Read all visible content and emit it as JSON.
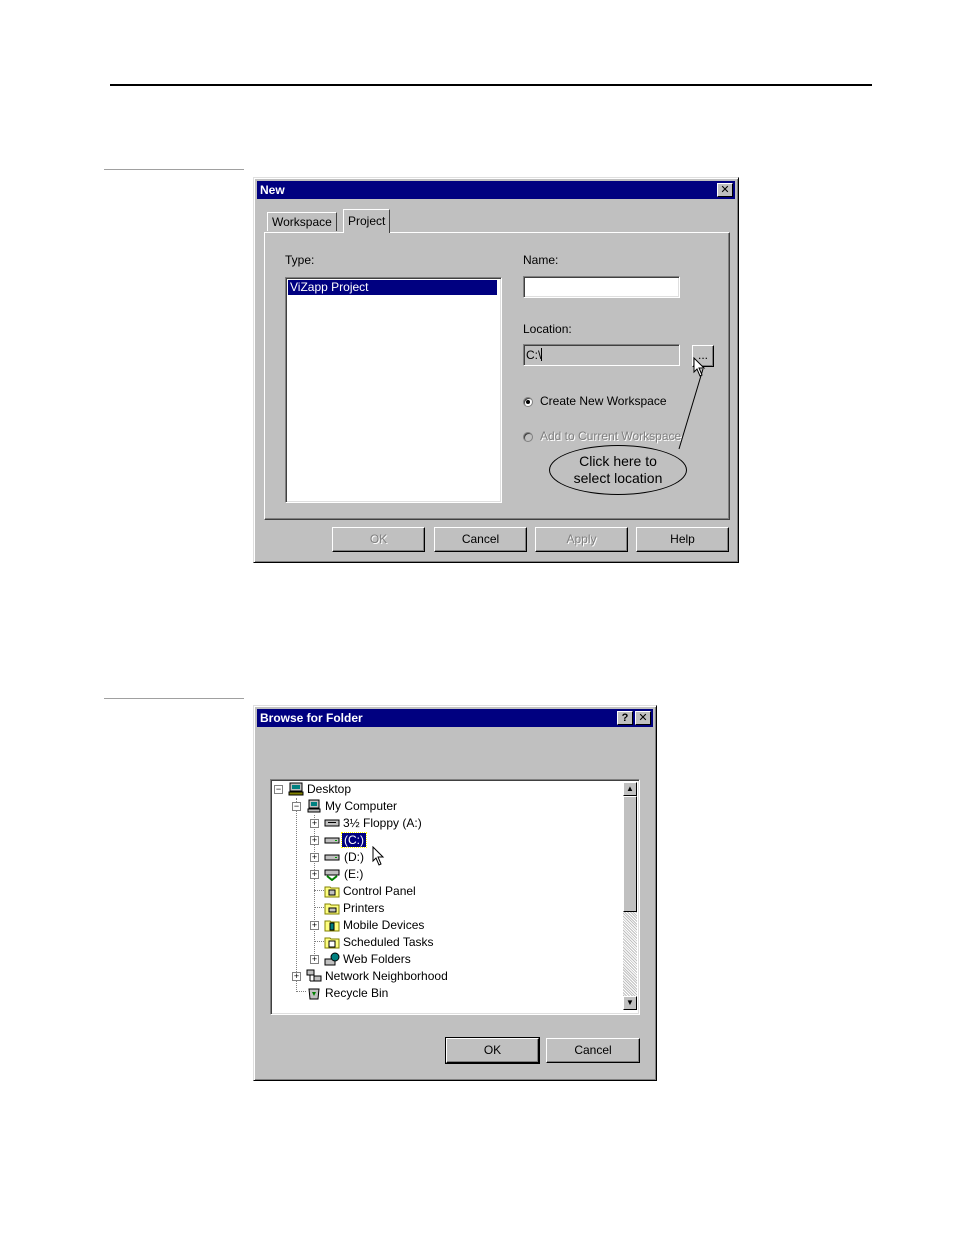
{
  "new_dialog": {
    "title": "New",
    "close_glyph": "✕",
    "tabs": [
      {
        "label": "Workspace",
        "active": false
      },
      {
        "label": "Project",
        "active": true
      }
    ],
    "type_label": "Type:",
    "type_items": [
      {
        "label": "ViZapp Project",
        "selected": true
      }
    ],
    "name_label": "Name:",
    "name_value": "",
    "location_label": "Location:",
    "location_value": "C:\\",
    "browse_button": "...",
    "radio_create": {
      "label": "Create New Workspace",
      "checked": true,
      "enabled": true
    },
    "radio_add": {
      "label": "Add to Current Workspace",
      "checked": false,
      "enabled": false
    },
    "callout_line1": "Click here to",
    "callout_line2": "select location",
    "buttons": {
      "ok": "OK",
      "cancel": "Cancel",
      "apply": "Apply",
      "help": "Help"
    }
  },
  "browse_dialog": {
    "title": "Browse for Folder",
    "help_glyph": "?",
    "close_glyph": "✕",
    "tree": [
      {
        "label": "Desktop",
        "icon": "desktop-icon",
        "expander": "−"
      },
      {
        "label": "My Computer",
        "icon": "computer-icon",
        "expander": "−"
      },
      {
        "label": "3½ Floppy (A:)",
        "icon": "floppy-drive-icon",
        "expander": "+"
      },
      {
        "label": "(C:)",
        "icon": "hard-drive-icon",
        "expander": "+",
        "selected": true
      },
      {
        "label": "(D:)",
        "icon": "hard-drive-icon",
        "expander": "+"
      },
      {
        "label": "(E:)",
        "icon": "network-drive-icon",
        "expander": "+"
      },
      {
        "label": "Control Panel",
        "icon": "control-panel-icon",
        "expander": ""
      },
      {
        "label": "Printers",
        "icon": "printers-icon",
        "expander": ""
      },
      {
        "label": "Mobile Devices",
        "icon": "mobile-devices-icon",
        "expander": "+"
      },
      {
        "label": "Scheduled Tasks",
        "icon": "scheduled-tasks-icon",
        "expander": ""
      },
      {
        "label": "Web Folders",
        "icon": "web-folders-icon",
        "expander": "+"
      },
      {
        "label": "Network Neighborhood",
        "icon": "network-icon",
        "expander": "+"
      },
      {
        "label": "Recycle Bin",
        "icon": "recycle-bin-icon",
        "expander": ""
      }
    ],
    "buttons": {
      "ok": "OK",
      "cancel": "Cancel"
    }
  },
  "colors": {
    "titlebar": "#000080",
    "selection": "#000080",
    "face": "#c0c0c0"
  }
}
